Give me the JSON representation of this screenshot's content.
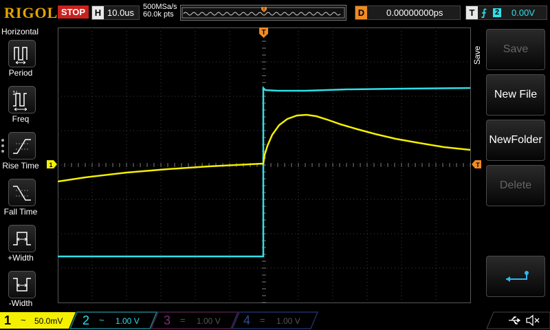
{
  "app": {
    "logo": "RIGOL"
  },
  "top": {
    "run_status": "STOP",
    "horizontal": {
      "tag": "H",
      "timebase": "10.0us"
    },
    "acquisition": {
      "sample_rate": "500MSa/s",
      "points": "60.0k pts"
    },
    "delay": {
      "tag": "D",
      "value": "0.00000000ps"
    },
    "trigger": {
      "tag": "T",
      "edge": "rising-edge-icon",
      "source": "2",
      "level": "0.00V"
    }
  },
  "left_panel": {
    "title": "Horizontal",
    "items": [
      {
        "label": "Period",
        "icon": "period-icon"
      },
      {
        "label": "Freq",
        "icon": "frequency-icon"
      },
      {
        "label": "Rise Time",
        "icon": "rise-time-icon"
      },
      {
        "label": "Fall Time",
        "icon": "fall-time-icon"
      },
      {
        "label": "+Width",
        "icon": "positive-width-icon"
      },
      {
        "label": "-Width",
        "icon": "negative-width-icon"
      }
    ]
  },
  "right_panel": {
    "title": "Save",
    "buttons": [
      {
        "label": "Save",
        "enabled": false
      },
      {
        "label": "New File",
        "enabled": true
      },
      {
        "label": "NewFolder",
        "enabled": true
      },
      {
        "label": "Delete",
        "enabled": false
      },
      {
        "label": "",
        "icon": "return-arrow-icon",
        "enabled": true
      }
    ]
  },
  "markers": {
    "trigger_position": "T",
    "ch1_ground": "1"
  },
  "channels": [
    {
      "num": "1",
      "coupling": "~",
      "scale": "50.0mV",
      "color": "#f4f000",
      "active": true
    },
    {
      "num": "2",
      "coupling": "~",
      "scale": "1.00 V",
      "color": "#30e0e8",
      "active": true
    },
    {
      "num": "3",
      "coupling": "=",
      "scale": "1.00 V",
      "color": "#c0209a",
      "active": false
    },
    {
      "num": "4",
      "coupling": "=",
      "scale": "1.00 V",
      "color": "#3060e0",
      "active": false
    }
  ],
  "status_icons": [
    "usb-icon",
    "sound-mute-icon"
  ],
  "colors": {
    "ch1": "#f4f000",
    "ch2": "#30e0e8",
    "trigger_marker": "#f08a24",
    "stop": "#c8221e"
  }
}
